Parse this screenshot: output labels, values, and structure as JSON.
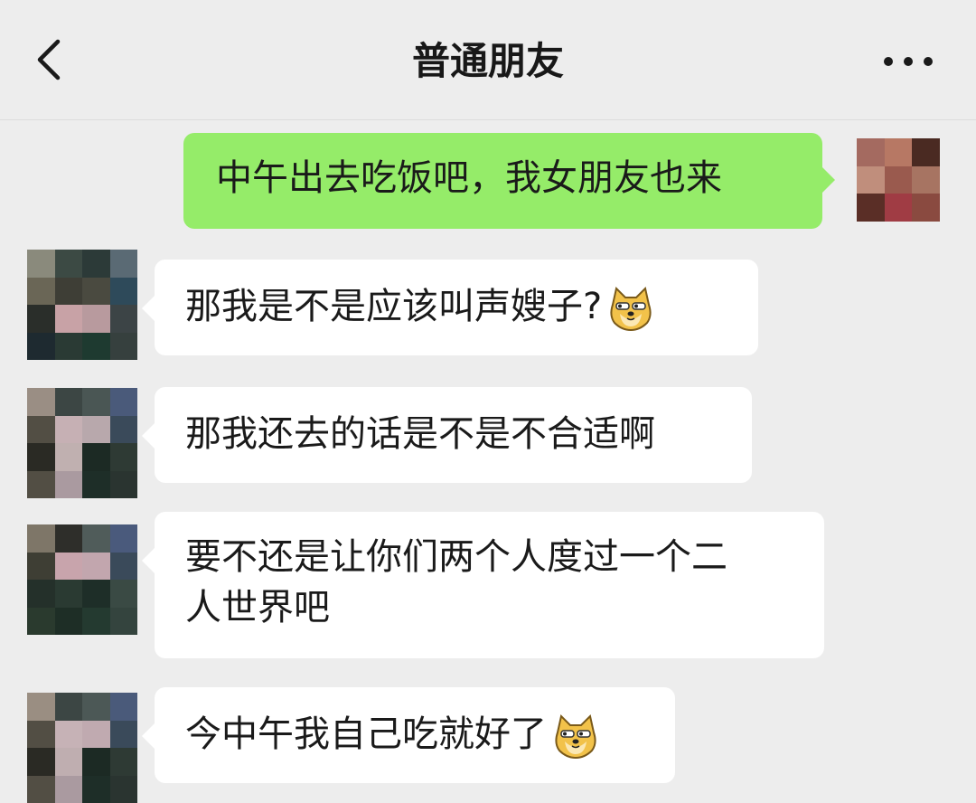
{
  "header": {
    "title": "普通朋友",
    "back_icon": "chevron-left-icon",
    "more_icon": "more-dots-icon"
  },
  "messages": [
    {
      "direction": "out",
      "text": "中午出去吃饭吧，我女朋友也来"
    },
    {
      "direction": "in",
      "text": "那我是不是应该叫声嫂子?",
      "emoji": "doge-emoji-icon"
    },
    {
      "direction": "in",
      "text": "那我还去的话是不是不合适啊"
    },
    {
      "direction": "in",
      "text_line1": "要不还是让你们两个人度过一个二",
      "text_line2": "人世界吧"
    },
    {
      "direction": "in",
      "text": "今中午我自己吃就好了",
      "emoji": "doge-emoji-icon"
    }
  ],
  "colors": {
    "background": "#ededed",
    "incoming_bubble": "#ffffff",
    "outgoing_bubble": "#95ec69"
  }
}
